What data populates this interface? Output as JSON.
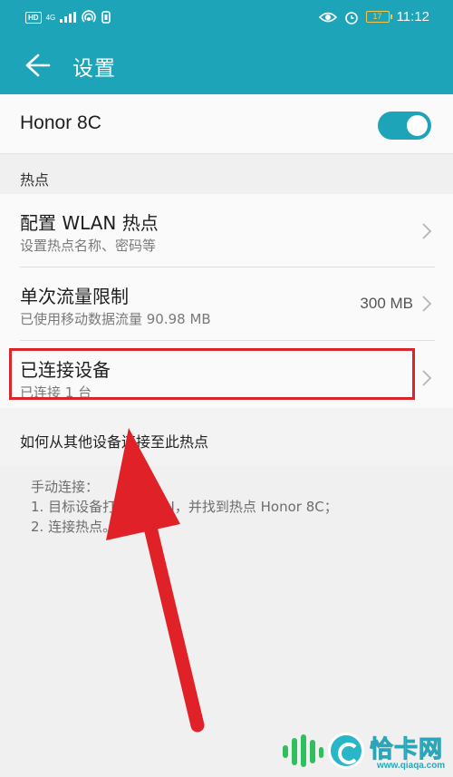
{
  "status_bar": {
    "hd": "HD",
    "network": "4G",
    "time": "11:12",
    "battery_level": "17"
  },
  "app_bar": {
    "title": "设置"
  },
  "hotspot_toggle": {
    "label": "Honor 8C",
    "enabled": true
  },
  "section_hotspot": {
    "header": "热点"
  },
  "items": [
    {
      "title": "配置 WLAN 热点",
      "subtitle": "设置热点名称、密码等",
      "value": ""
    },
    {
      "title": "单次流量限制",
      "subtitle": "已使用移动数据流量 90.98 MB",
      "value": "300 MB"
    },
    {
      "title": "已连接设备",
      "subtitle": "已连接 1 台",
      "value": ""
    }
  ],
  "section_connect": {
    "header": "如何从其他设备连接至此热点"
  },
  "instructions": {
    "line1": "手动连接：",
    "line2": "1. 目标设备打开 WLAN，并找到热点 Honor 8C；",
    "line3": "2. 连接热点。"
  },
  "colors": {
    "accent": "#1ea4b8",
    "highlight": "#d9262c",
    "arrow": "#e02128"
  },
  "watermark": {
    "brand": "恰卡网",
    "url": "www.qiaqa.com"
  }
}
